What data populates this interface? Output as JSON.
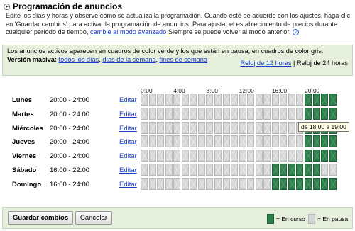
{
  "title": "Programación de anuncios",
  "intro": {
    "text": "Edite los días y horas y observe cómo se actualiza la programación. Cuando esté de acuerdo con los ajustes, haga clic en 'Guardar cambios' para activar la programación de anuncios. Para ajustar el establecimiento de precios durante cualquier período de tiempo, ",
    "link": "cambie al modo avanzado",
    "after": " Siempre se puede volver al modo anterior.",
    "help": "?"
  },
  "info": {
    "line1": "Los anuncios activos aparecen en cuadros de color verde y los que están en pausa, en cuadros de color gris.",
    "massive_label": "Versión masiva:",
    "links": [
      "todos los días",
      "días de la semana",
      "fines de semana"
    ],
    "clock12": "Reloj de 12 horas",
    "clock24": "Reloj de 24 horas"
  },
  "hours": [
    "0:00",
    "4:00",
    "8:00",
    "12:00",
    "16:00",
    "20:00"
  ],
  "edit_label": "Editar",
  "days": [
    {
      "name": "Lunes",
      "start": "20:00",
      "end": "24:00"
    },
    {
      "name": "Martes",
      "start": "20:00",
      "end": "24:00"
    },
    {
      "name": "Miércoles",
      "start": "20:00",
      "end": "24:00"
    },
    {
      "name": "Jueves",
      "start": "20:00",
      "end": "24:00"
    },
    {
      "name": "Viernes",
      "start": "20:00",
      "end": "24:00"
    },
    {
      "name": "Sábado",
      "start": "16:00",
      "end": "22:00"
    },
    {
      "name": "Domingo",
      "start": "16:00",
      "end": "24:00"
    }
  ],
  "tooltip": "de 18:00 a 19:00",
  "footer": {
    "save": "Guardar cambios",
    "cancel": "Cancelar",
    "legend_on": "= En curso",
    "legend_off": "= En pausa"
  }
}
